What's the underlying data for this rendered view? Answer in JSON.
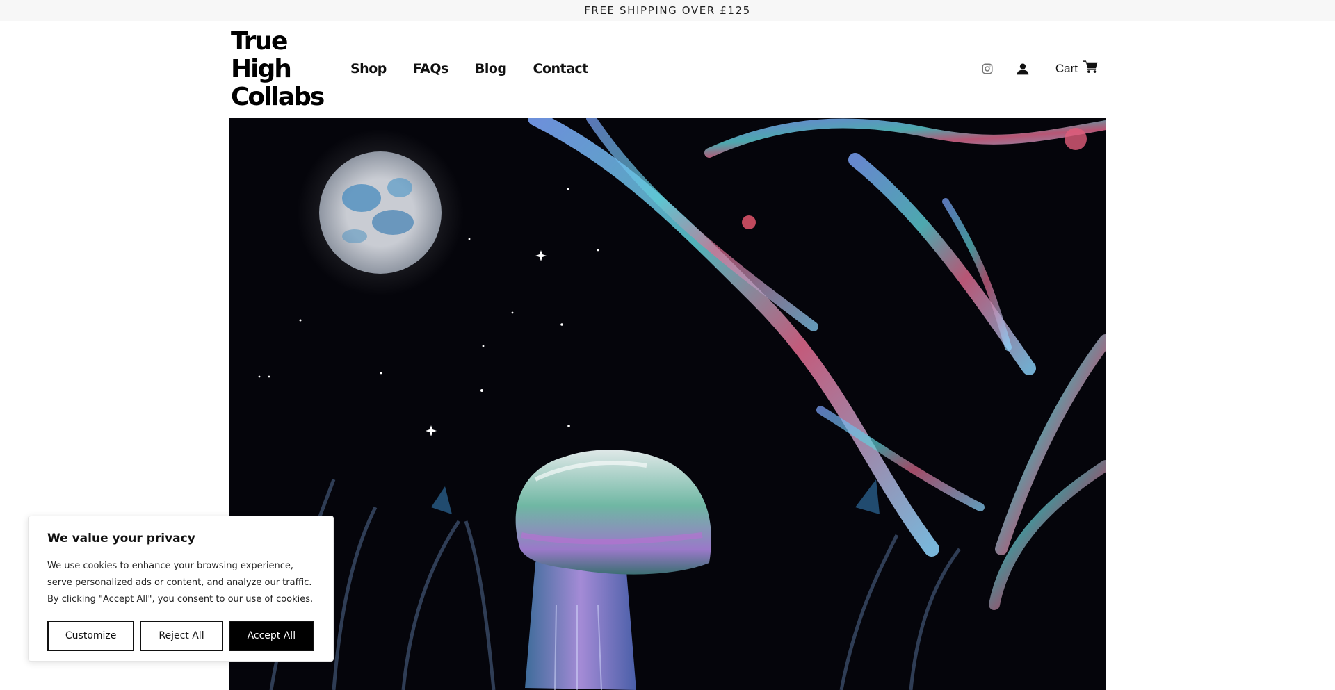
{
  "announcement": "FREE SHIPPING OVER £125",
  "brand": {
    "name": "True\nHigh\nCollabs"
  },
  "nav": {
    "items": [
      "Shop",
      "FAQs",
      "Blog",
      "Contact"
    ]
  },
  "header_icons": {
    "instagram": "instagram-icon",
    "account": "user-icon",
    "cart_label": "Cart",
    "cart_icon": "cart-icon"
  },
  "cookie_banner": {
    "title": "We value your privacy",
    "body": "We use cookies to enhance your browsing experience, serve personalized ads or content, and analyze our traffic. By clicking \"Accept All\", you consent to our use of cookies.",
    "customize_label": "Customize",
    "reject_label": "Reject All",
    "accept_label": "Accept All"
  },
  "colors": {
    "announcement_bg": "#f7f7f7",
    "accept_bg": "#000000",
    "text": "#111111"
  }
}
